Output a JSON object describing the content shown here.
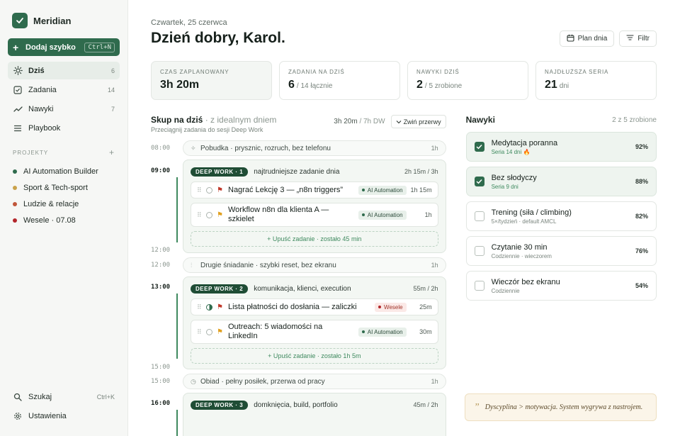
{
  "app": {
    "name": "Meridian"
  },
  "quick_add": {
    "label": "Dodaj szybko",
    "shortcut": "Ctrl+N"
  },
  "nav": [
    {
      "label": "Dziś",
      "count": "6",
      "icon": "sun-icon"
    },
    {
      "label": "Zadania",
      "count": "14",
      "icon": "checkbox-icon"
    },
    {
      "label": "Nawyki",
      "count": "7",
      "icon": "trend-icon"
    },
    {
      "label": "Playbook",
      "count": "",
      "icon": "list-icon"
    }
  ],
  "projects": {
    "heading": "PROJEKTY",
    "items": [
      {
        "label": "AI Automation Builder",
        "color": "#2f6b4d"
      },
      {
        "label": "Sport & Tech-sport",
        "color": "#c9a24a"
      },
      {
        "label": "Ludzie & relacje",
        "color": "#c0563a"
      },
      {
        "label": "Wesele · 07.08",
        "color": "#b3262a"
      }
    ]
  },
  "bottom_nav": {
    "search": {
      "label": "Szukaj",
      "shortcut": "Ctrl+K"
    },
    "settings": {
      "label": "Ustawienia"
    }
  },
  "header": {
    "date": "Czwartek, 25 czerwca",
    "greeting": "Dzień dobry, Karol.",
    "plan_button": "Plan dnia",
    "filter_button": "Filtr"
  },
  "stats": [
    {
      "label": "CZAS ZAPLANOWANY",
      "value": "3h 20m",
      "sub": ""
    },
    {
      "label": "ZADANIA NA DZIŚ",
      "value": "6",
      "sub": "/ 14 łącznie"
    },
    {
      "label": "NAWYKI DZIŚ",
      "value": "2",
      "sub": "/ 5 zrobione"
    },
    {
      "label": "NAJDŁUŻSZA SERIA",
      "value": "21",
      "sub": "dni"
    }
  ],
  "focus": {
    "title": "Skup na dziś",
    "title_muted": "· z idealnym dniem",
    "subtitle": "Przeciągnij zadania do sesji Deep Work",
    "planned": "3h 20m",
    "planned_total": "/ 7h DW",
    "collapse_button": "Zwiń przerwy"
  },
  "timeline": {
    "t0800": "08:00",
    "pill1": {
      "label": "Pobudka · prysznic, rozruch, bez telefonu",
      "dur": "1h"
    },
    "t0900": "09:00",
    "block1": {
      "badge": "DEEP WORK · 1",
      "desc": "najtrudniejsze zadanie dnia",
      "dur": "2h 15m / 3h",
      "tasks": [
        {
          "title": "Nagrać Lekcję 3 — „n8n triggers”",
          "tag": "AI Automation",
          "dur": "1h 15m"
        },
        {
          "title": "Workflow n8n dla klienta A — szkielet",
          "tag": "AI Automation",
          "dur": "1h"
        }
      ],
      "drop": "Upuść zadanie · zostało 45 min"
    },
    "t1200a": "12:00",
    "t1200b": "12:00",
    "pill2": {
      "label": "Drugie śniadanie · szybki reset, bez ekranu",
      "dur": "1h"
    },
    "t1300": "13:00",
    "block2": {
      "badge": "DEEP WORK · 2",
      "desc": "komunikacja, klienci, execution",
      "dur": "55m / 2h",
      "tasks": [
        {
          "title": "Lista płatności do dosłania — zaliczki",
          "tag": "Wesele",
          "dur": "25m"
        },
        {
          "title": "Outreach: 5 wiadomości na LinkedIn",
          "tag": "AI Automation",
          "dur": "30m"
        }
      ],
      "drop": "Upuść zadanie · zostało 1h 5m"
    },
    "t1500a": "15:00",
    "t1500b": "15:00",
    "pill3": {
      "label": "Obiad · pełny posiłek, przerwa od pracy",
      "dur": "1h"
    },
    "t1600": "16:00",
    "block3": {
      "badge": "DEEP WORK · 3",
      "desc": "domknięcia, build, portfolio",
      "dur": "45m / 2h"
    }
  },
  "habits": {
    "title": "Nawyki",
    "count": "2 z 5 zrobione",
    "items": [
      {
        "name": "Medytacja poranna",
        "sub": "Seria 14 dni 🔥",
        "pct": "92%",
        "done": true
      },
      {
        "name": "Bez słodyczy",
        "sub": "Seria 9 dni",
        "pct": "88%",
        "done": true
      },
      {
        "name": "Trening (siła / climbing)",
        "sub": "5×/tydzień · default AMCL",
        "pct": "82%",
        "done": false
      },
      {
        "name": "Czytanie 30 min",
        "sub": "Codziennie · wieczorem",
        "pct": "76%",
        "done": false
      },
      {
        "name": "Wieczór bez ekranu",
        "sub": "Codziennie",
        "pct": "54%",
        "done": false
      }
    ]
  },
  "quote": "Dyscyplina > motywacja. System wygrywa z nastrojem.",
  "colors": {
    "accent": "#2f6b4d",
    "accent_light": "#3f8a5f",
    "danger": "#c0392b",
    "warning": "#e0a020"
  }
}
